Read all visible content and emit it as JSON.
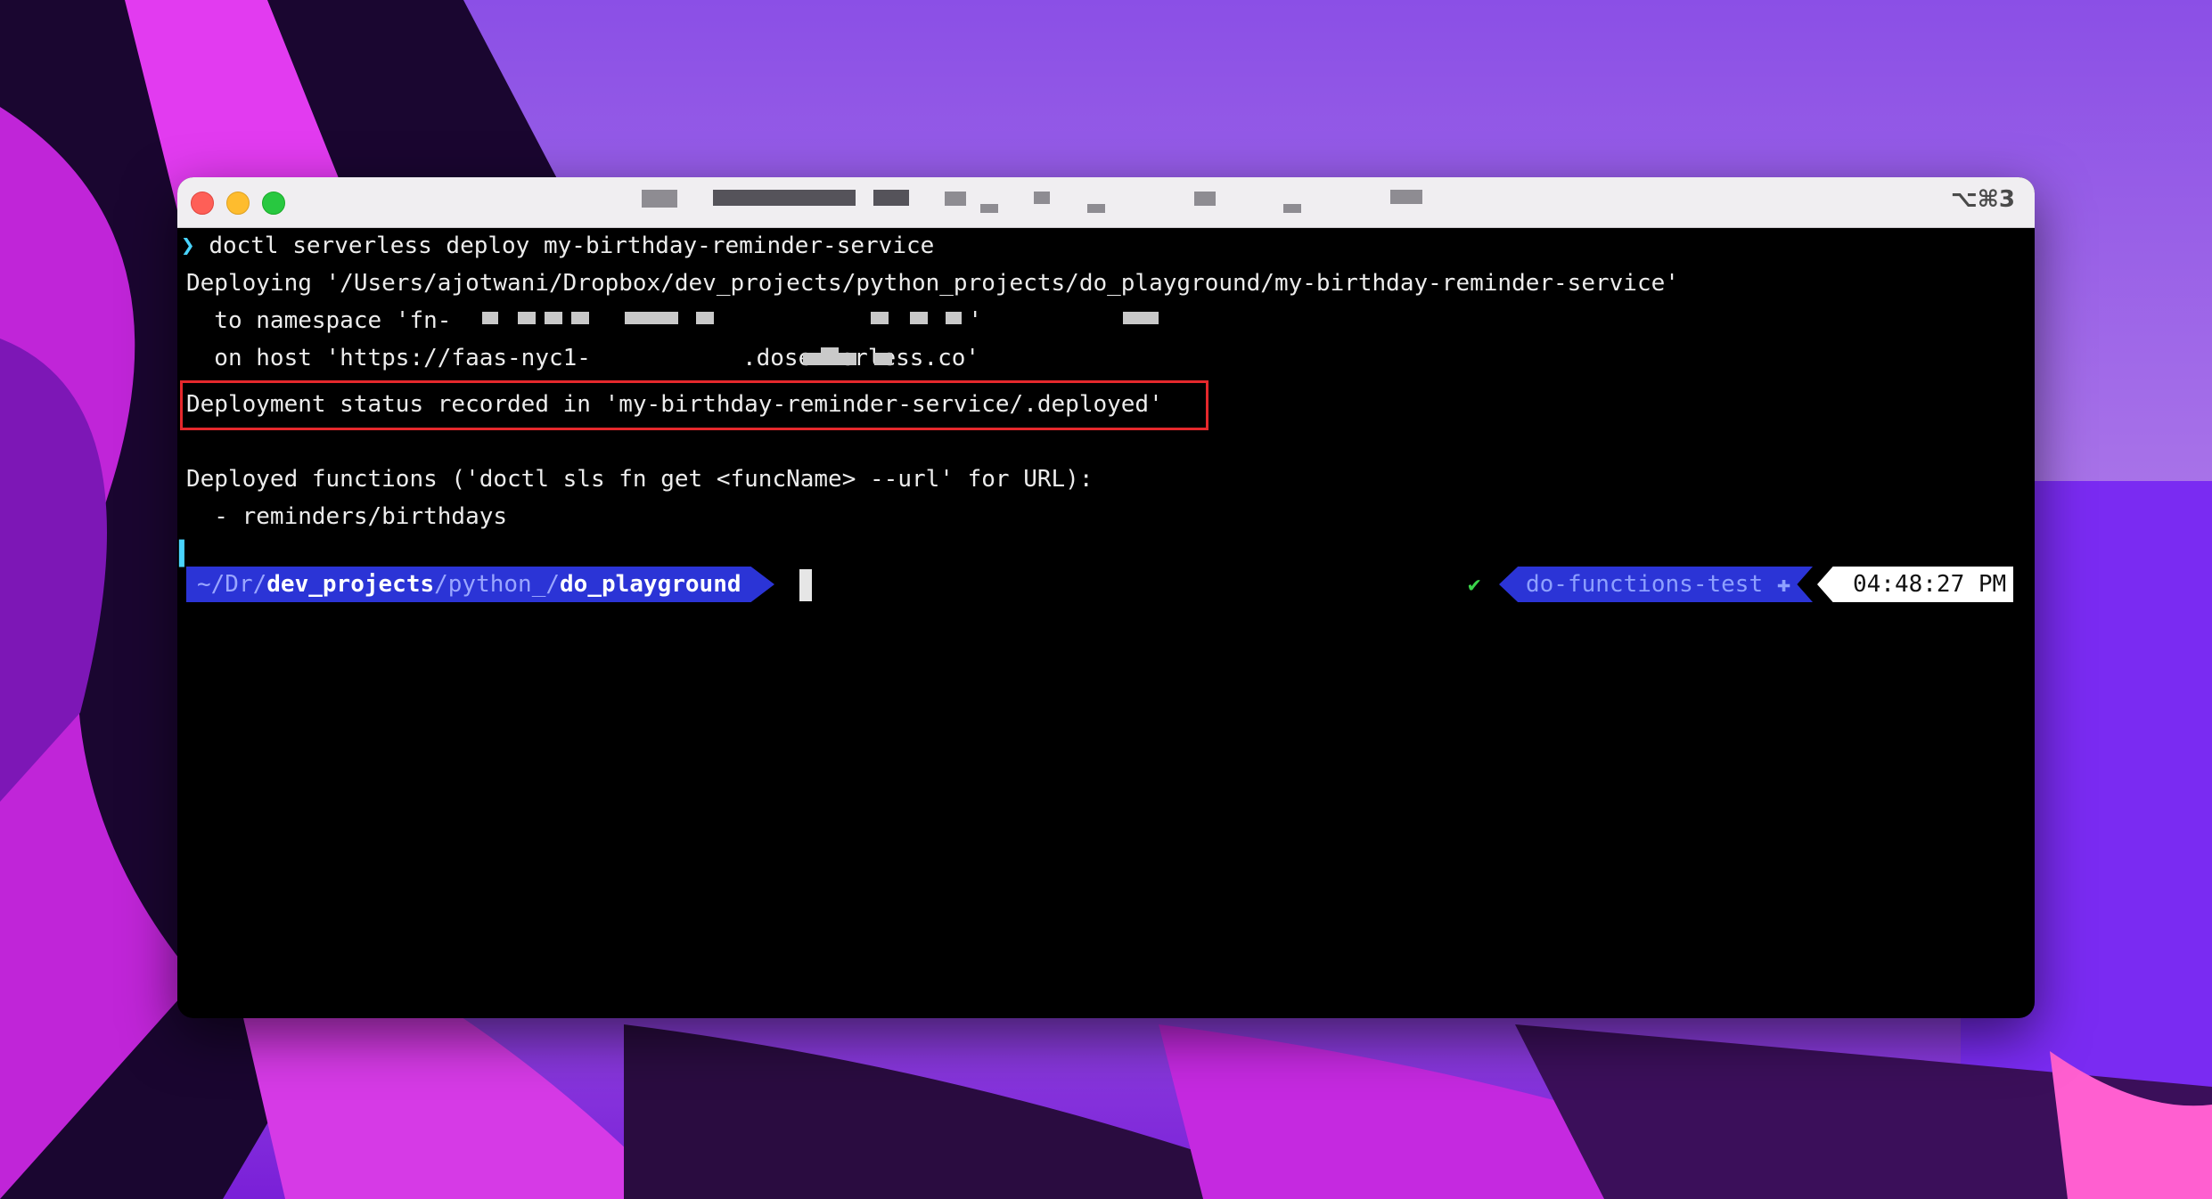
{
  "window": {
    "shortcut": "⌥⌘3"
  },
  "terminal": {
    "lines": {
      "cmd": "doctl serverless deploy my-birthday-reminder-service",
      "deploying": "Deploying '/Users/ajotwani/Dropbox/dev_projects/python_projects/do_playground/my-birthday-reminder-service'",
      "namespace_prefix": "  to namespace 'fn-",
      "namespace_suffix": "'",
      "host_prefix": "  on host 'https://faas-nyc1-",
      "host_suffix": ".doserverless.co'",
      "status": "Deployment status recorded in 'my-birthday-reminder-service/.deployed'",
      "functions_header": "Deployed functions ('doctl sls fn get <funcName> --url' for URL):",
      "function_item": "  - reminders/birthdays"
    },
    "prompt": {
      "arrow": "❯",
      "path_dim1": "~/Dr/",
      "path_bold1": "dev_projects",
      "path_dim2": "/python_/",
      "path_bold2": "do_playground",
      "status_check": "✔",
      "context": "do-functions-test ✚",
      "time": "04:48:27 PM"
    }
  },
  "colors": {
    "prompt_segment": "#2b34d6",
    "highlight_box": "#e5282c",
    "terminal_bg": "#000000"
  }
}
